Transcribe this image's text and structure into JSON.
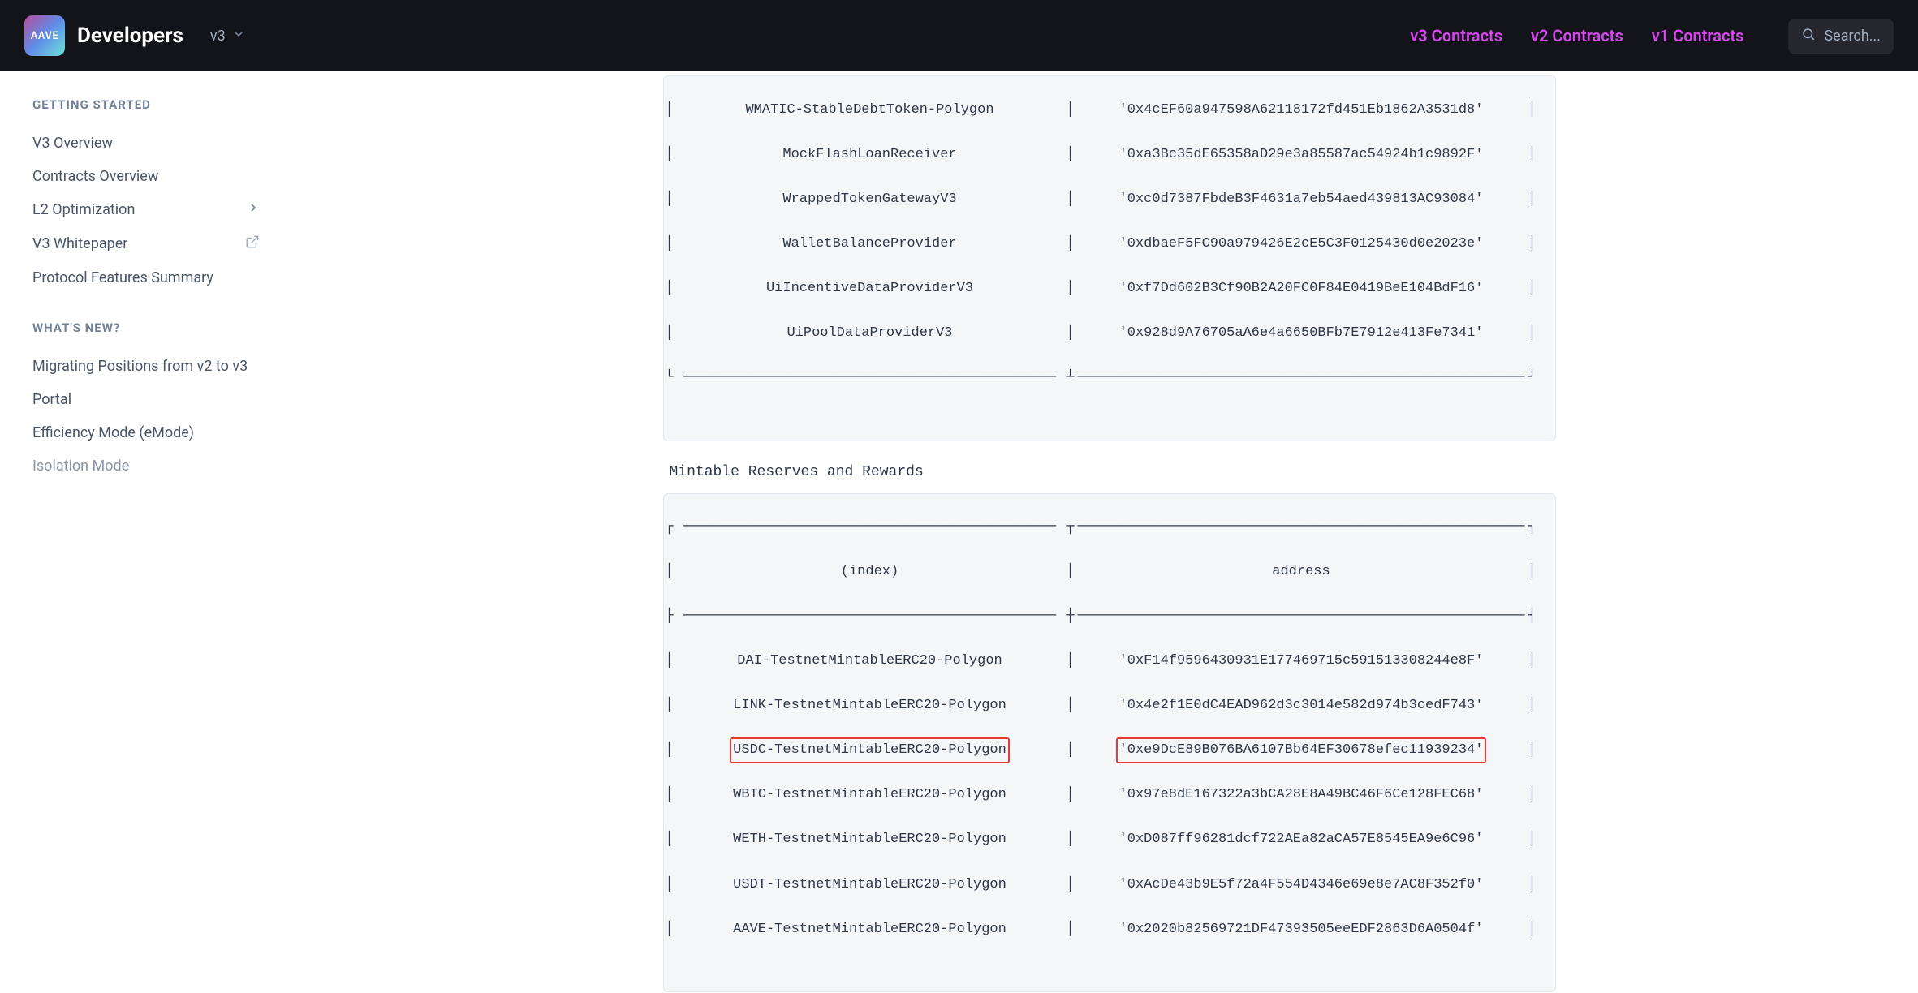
{
  "header": {
    "logo_text": "AAVE",
    "brand": "Developers",
    "version": "v3",
    "nav": {
      "v3": "v3 Contracts",
      "v2": "v2 Contracts",
      "v1": "v1 Contracts"
    },
    "search_placeholder": "Search..."
  },
  "sidebar": {
    "section1_title": "GETTING STARTED",
    "items1": {
      "overview": "V3 Overview",
      "contracts": "Contracts Overview",
      "l2": "L2 Optimization",
      "whitepaper": "V3 Whitepaper",
      "features": "Protocol Features Summary"
    },
    "section2_title": "WHAT'S NEW?",
    "items2": {
      "migrating": "Migrating Positions from v2 to v3",
      "portal": "Portal",
      "emode": "Efficiency Mode (eMode)",
      "isolation": "Isolation Mode"
    }
  },
  "content": {
    "table1": {
      "rows": [
        {
          "name": "WMATIC-StableDebtToken-Polygon",
          "addr": "'0x4cEF60a947598A62118172fd451Eb1862A3531d8'"
        },
        {
          "name": "MockFlashLoanReceiver",
          "addr": "'0xa3Bc35dE65358aD29e3a85587ac54924b1c9892F'"
        },
        {
          "name": "WrappedTokenGatewayV3",
          "addr": "'0xc0d7387FbdeB3F4631a7eb54aed439813AC93084'"
        },
        {
          "name": "WalletBalanceProvider",
          "addr": "'0xdbaeF5FC90a979426E2cE5C3F0125430d0e2023e'"
        },
        {
          "name": "UiIncentiveDataProviderV3",
          "addr": "'0xf7Dd602B3Cf90B2A20FC0F84E0419BeE104BdF16'"
        },
        {
          "name": "UiPoolDataProviderV3",
          "addr": "'0x928d9A76705aA6e4a6650BFb7E7912e413Fe7341'"
        }
      ]
    },
    "section_label": "Mintable Reserves and Rewards",
    "table2": {
      "header_col1": "(index)",
      "header_col2": "address",
      "rows": [
        {
          "name": "DAI-TestnetMintableERC20-Polygon",
          "addr": "'0xF14f9596430931E177469715c591513308244e8F'"
        },
        {
          "name": "LINK-TestnetMintableERC20-Polygon",
          "addr": "'0x4e2f1E0dC4EAD962d3c3014e582d974b3cedF743'"
        },
        {
          "name": "USDC-TestnetMintableERC20-Polygon",
          "addr": "'0xe9DcE89B076BA6107Bb64EF30678efec11939234'"
        },
        {
          "name": "WBTC-TestnetMintableERC20-Polygon",
          "addr": "'0x97e8dE167322a3bCA28E8A49BC46F6Ce128FEC68'"
        },
        {
          "name": "WETH-TestnetMintableERC20-Polygon",
          "addr": "'0xD087ff96281dcf722AEa82aCA57E8545EA9e6C96'"
        },
        {
          "name": "USDT-TestnetMintableERC20-Polygon",
          "addr": "'0xAcDe43b9E5f72a4F554D4346e69e8e7AC8F352f0'"
        },
        {
          "name": "AAVE-TestnetMintableERC20-Polygon",
          "addr": "'0x2020b82569721DF47393505eeEDF2863D6A0504f'"
        }
      ]
    }
  }
}
